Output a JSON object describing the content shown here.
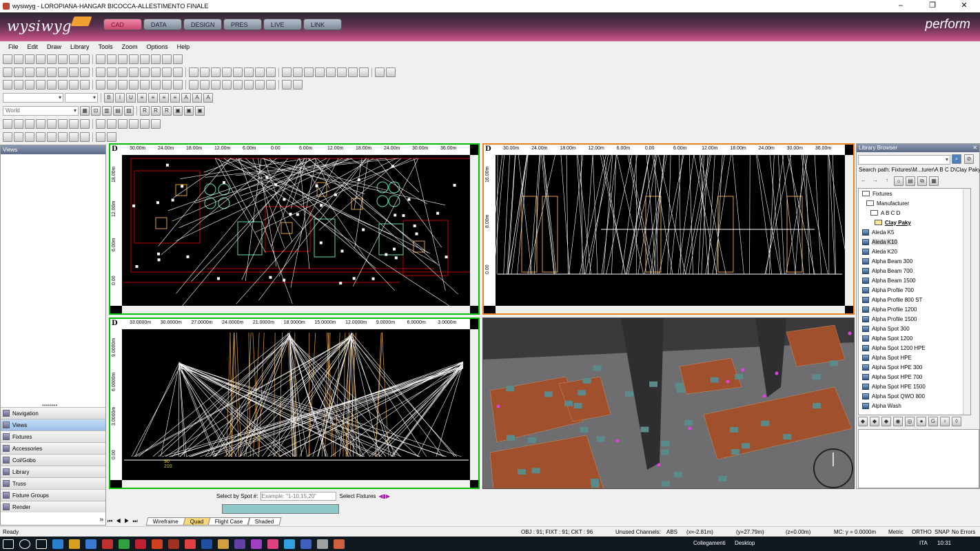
{
  "window": {
    "title": "wysiwyg - LOROPIANA-HANGAR BICOCCA-ALLESTIMENTO FINALE",
    "minimize": "–",
    "maximize": "❐",
    "close": "✕"
  },
  "brand": {
    "logo": "wysiwyg",
    "product": "perform",
    "tabs": [
      "CAD",
      "DATA",
      "DESIGN",
      "PRES",
      "LIVE",
      "LINK"
    ],
    "active_tab": "CAD"
  },
  "menu": [
    "File",
    "Edit",
    "Draw",
    "Library",
    "Tools",
    "Zoom",
    "Options",
    "Help"
  ],
  "toolbar": {
    "layer_combo": "World"
  },
  "left_panel": {
    "title": "Views",
    "items": [
      "Navigation",
      "Views",
      "Fixtures",
      "Accessories",
      "Col/Gobo",
      "Library",
      "Truss",
      "Fixture Groups",
      "Render"
    ],
    "selected": "Views",
    "more": "»"
  },
  "viewport_tl": {
    "d_mark": "D",
    "top_ticks": [
      "30.00m",
      "24.00m",
      "18.00m",
      "12.00m",
      "6.00m",
      "0.00",
      "6.00m",
      "12.00m",
      "18.00m",
      "24.00m",
      "30.00m",
      "36.00m"
    ],
    "left_ticks": [
      "18.00m",
      "12.00m",
      "6.00m",
      "0.00"
    ]
  },
  "viewport_tr": {
    "d_mark": "D",
    "top_ticks": [
      "30.00m",
      "24.00m",
      "18.00m",
      "12.00m",
      "6.00m",
      "0.00",
      "6.00m",
      "12.00m",
      "18.00m",
      "24.00m",
      "30.00m",
      "36.00m"
    ],
    "left_ticks": [
      "16.00m",
      "8.00m",
      "0.00"
    ]
  },
  "viewport_bl": {
    "d_mark": "D",
    "top_ticks": [
      "33.0000m",
      "30.0000m",
      "27.0000m",
      "24.0000m",
      "21.0000m",
      "18.0000m",
      "15.0000m",
      "12.0000m",
      "9.0000m",
      "6.0000m",
      "3.0000m"
    ],
    "left_ticks": [
      "9.0000m",
      "6.0000m",
      "3.0000m",
      "0.00"
    ],
    "labels": [
      "90",
      "210"
    ]
  },
  "library": {
    "title": "Library Browser",
    "close": "✕",
    "search_path": "Search path: Fixtures\\M...turer\\A B C D\\Clay Paky",
    "tree": [
      {
        "label": "Fixtures",
        "type": "folder",
        "indent": 0
      },
      {
        "label": "Manufacturer",
        "type": "folder",
        "indent": 1
      },
      {
        "label": "A B C D",
        "type": "folder",
        "indent": 2
      },
      {
        "label": "Clay Paky",
        "type": "folder-open",
        "indent": 3
      },
      {
        "label": "Aleda K5",
        "type": "item",
        "indent": 0
      },
      {
        "label": "Aleda K10",
        "type": "item",
        "indent": 0,
        "selected": true
      },
      {
        "label": "Aleda K20",
        "type": "item",
        "indent": 0
      },
      {
        "label": "Alpha Beam 300",
        "type": "item",
        "indent": 0
      },
      {
        "label": "Alpha Beam 700",
        "type": "item",
        "indent": 0
      },
      {
        "label": "Alpha Beam 1500",
        "type": "item",
        "indent": 0
      },
      {
        "label": "Alpha Profile 700",
        "type": "item",
        "indent": 0
      },
      {
        "label": "Alpha Profile 800 ST",
        "type": "item",
        "indent": 0
      },
      {
        "label": "Alpha Profile 1200",
        "type": "item",
        "indent": 0
      },
      {
        "label": "Alpha Profile 1500",
        "type": "item",
        "indent": 0
      },
      {
        "label": "Alpha Spot 300",
        "type": "item",
        "indent": 0
      },
      {
        "label": "Alpha Spot 1200",
        "type": "item",
        "indent": 0
      },
      {
        "label": "Alpha Spot 1200 HPE",
        "type": "item",
        "indent": 0
      },
      {
        "label": "Alpha Spot HPE",
        "type": "item",
        "indent": 0
      },
      {
        "label": "Alpha Spot HPE 300",
        "type": "item",
        "indent": 0
      },
      {
        "label": "Alpha Spot HPE 700",
        "type": "item",
        "indent": 0
      },
      {
        "label": "Alpha Spot HPE 1500",
        "type": "item",
        "indent": 0
      },
      {
        "label": "Alpha Spot QWO 800",
        "type": "item",
        "indent": 0
      },
      {
        "label": "Alpha Wash",
        "type": "item",
        "indent": 0
      }
    ]
  },
  "bottom": {
    "select_by_spot": "Select by Spot #:",
    "spot_placeholder": "Example: \"1-10,15,20\"",
    "select_fixtures": "Select Fixtures",
    "progress": 1.0,
    "tabs": [
      "Wireframe",
      "Quad",
      "Flight Case",
      "Shaded"
    ],
    "active_tab": "Quad"
  },
  "status": {
    "ready": "Ready",
    "counts": "OBJ : 91; FIXT : 91; CKT : 96",
    "unused": "Unused Channels:",
    "abs": "ABS",
    "x": "(x=-2.81m)",
    "y": "(y=27.79m)",
    "z": "(z=0.00m)",
    "mc": "MC: y = 0.0000m",
    "units": "Metric",
    "ortho": "ORTHO",
    "snap": "SNAP",
    "errors": "No Errors"
  },
  "taskbar": {
    "links": "Collegamenti",
    "desktop": "Desktop",
    "lang": "ITA",
    "time": "10:31"
  },
  "colors": {
    "accent": "#c84a70",
    "grid_red": "#c00000",
    "select_green": "#00c000"
  }
}
